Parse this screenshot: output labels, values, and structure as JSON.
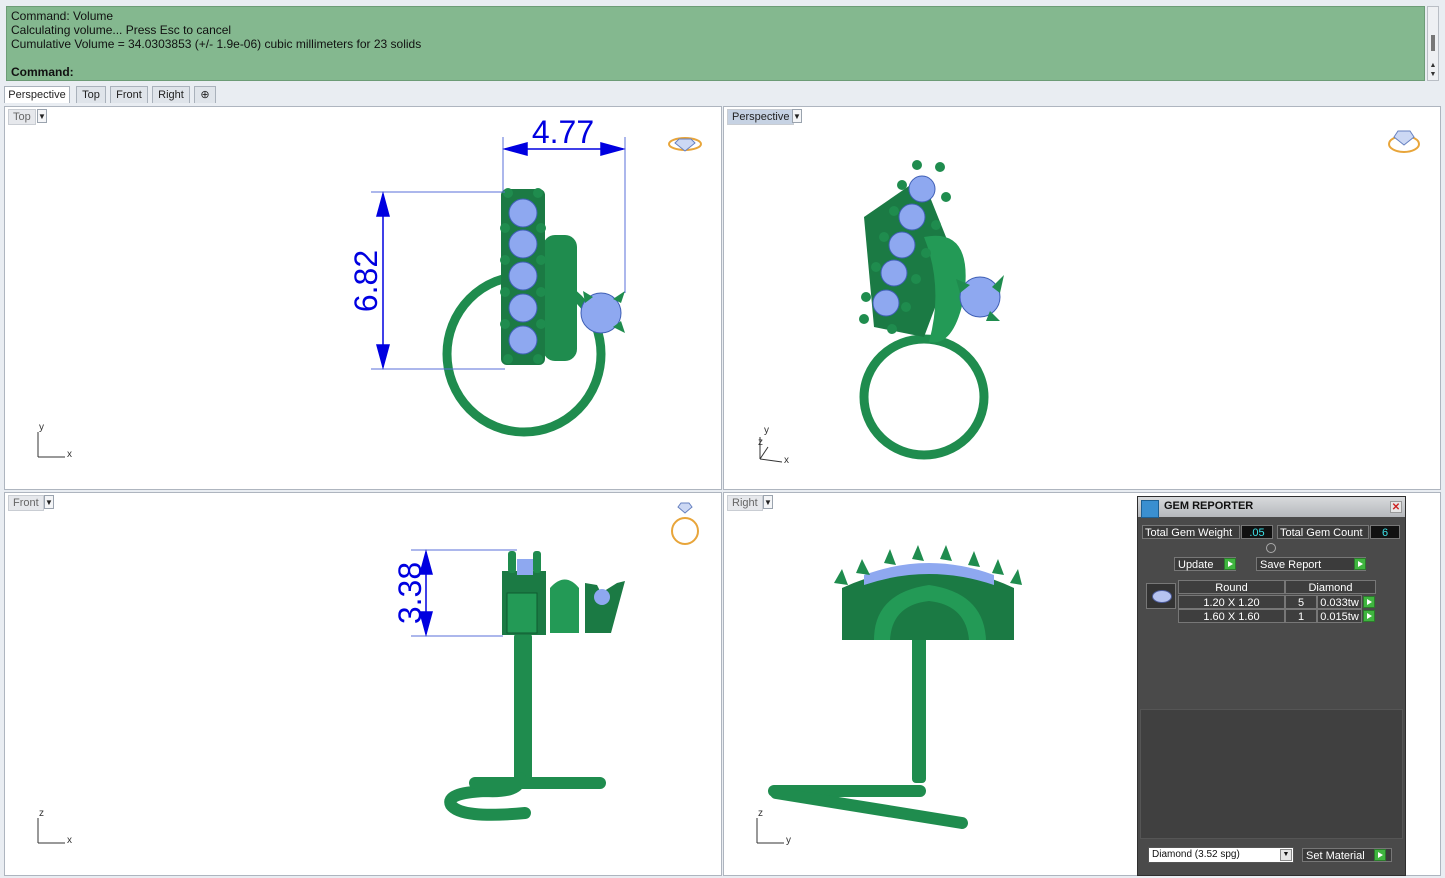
{
  "command_area": {
    "lines": [
      "Command: Volume",
      "Calculating volume... Press Esc to cancel",
      "Cumulative Volume = 34.0303853 (+/- 1.9e-06) cubic millimeters for 23 solids"
    ],
    "prompt": "Command:"
  },
  "tabs": [
    {
      "label": "Perspective",
      "active": true
    },
    {
      "label": "Top",
      "active": false
    },
    {
      "label": "Front",
      "active": false
    },
    {
      "label": "Right",
      "active": false
    }
  ],
  "add_tab_icon": "plus-icon",
  "viewports": {
    "top": {
      "label": "Top",
      "dimension_width": "4.77",
      "dimension_height": "6.82",
      "axis_x": "x",
      "axis_y": "y"
    },
    "perspective": {
      "label": "Perspective",
      "axis_x": "x",
      "axis_y": "y",
      "axis_z": "z"
    },
    "front": {
      "label": "Front",
      "dimension_height": "3.38",
      "axis_x": "x",
      "axis_z": "z"
    },
    "right": {
      "label": "Right",
      "axis_y": "y",
      "axis_z": "z"
    }
  },
  "gem_reporter": {
    "title": "GEM REPORTER",
    "total_gem_weight_label": "Total Gem Weight",
    "total_gem_weight_value": ".05",
    "total_gem_count_label": "Total Gem Count",
    "total_gem_count_value": "6",
    "update_label": "Update",
    "save_report_label": "Save Report",
    "table": {
      "headers": [
        "Round",
        "Diamond"
      ],
      "rows": [
        {
          "size": "1.20 X 1.20",
          "count": "5",
          "weight": "0.033tw"
        },
        {
          "size": "1.60 X 1.60",
          "count": "1",
          "weight": "0.015tw"
        }
      ]
    },
    "material_select": "Diamond    (3.52 spg)",
    "set_material_label": "Set Material"
  },
  "colors": {
    "command_bg": "#84b88f",
    "metal": "#1f8c4e",
    "gem": "#8ea8f0",
    "dimension": "#0000e0"
  }
}
